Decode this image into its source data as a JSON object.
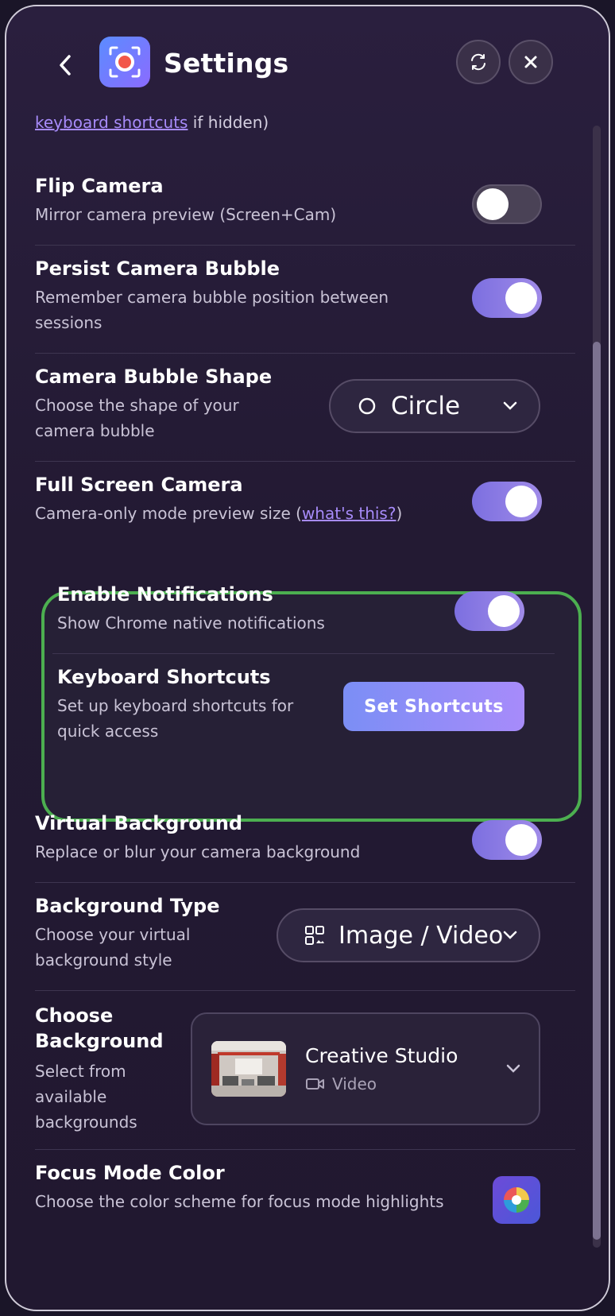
{
  "header": {
    "title": "Settings"
  },
  "intro": {
    "link": "keyboard shortcuts",
    "suffix": " if hidden)"
  },
  "flip_camera": {
    "title": "Flip Camera",
    "desc": "Mirror camera preview (Screen+Cam)",
    "on": false
  },
  "persist_bubble": {
    "title": "Persist Camera Bubble",
    "desc": "Remember camera bubble position between sessions",
    "on": true
  },
  "bubble_shape": {
    "title": "Camera Bubble Shape",
    "desc": "Choose the shape of your camera bubble",
    "value": "Circle"
  },
  "full_screen": {
    "title": "Full Screen Camera",
    "desc_prefix": "Camera-only mode preview size (",
    "link": "what's this?",
    "desc_suffix": ")",
    "on": true
  },
  "notifications": {
    "title": "Enable Notifications",
    "desc": "Show Chrome native notifications",
    "on": true
  },
  "shortcuts": {
    "title": "Keyboard Shortcuts",
    "desc": "Set up keyboard shortcuts for quick access",
    "button": "Set Shortcuts"
  },
  "virtual_bg": {
    "title": "Virtual Background",
    "desc": "Replace or blur your camera background",
    "on": true
  },
  "bg_type": {
    "title": "Background Type",
    "desc": "Choose your virtual background style",
    "value": "Image / Video"
  },
  "choose_bg": {
    "title": "Choose Background",
    "desc": "Select from available backgrounds",
    "name": "Creative Studio",
    "kind": "Video"
  },
  "focus_color": {
    "title": "Focus Mode Color",
    "desc": "Choose the color scheme for focus mode highlights"
  },
  "colors": {
    "accent": "#7c6fe0",
    "highlight_border": "#4caf50",
    "link": "#a78bfa"
  }
}
